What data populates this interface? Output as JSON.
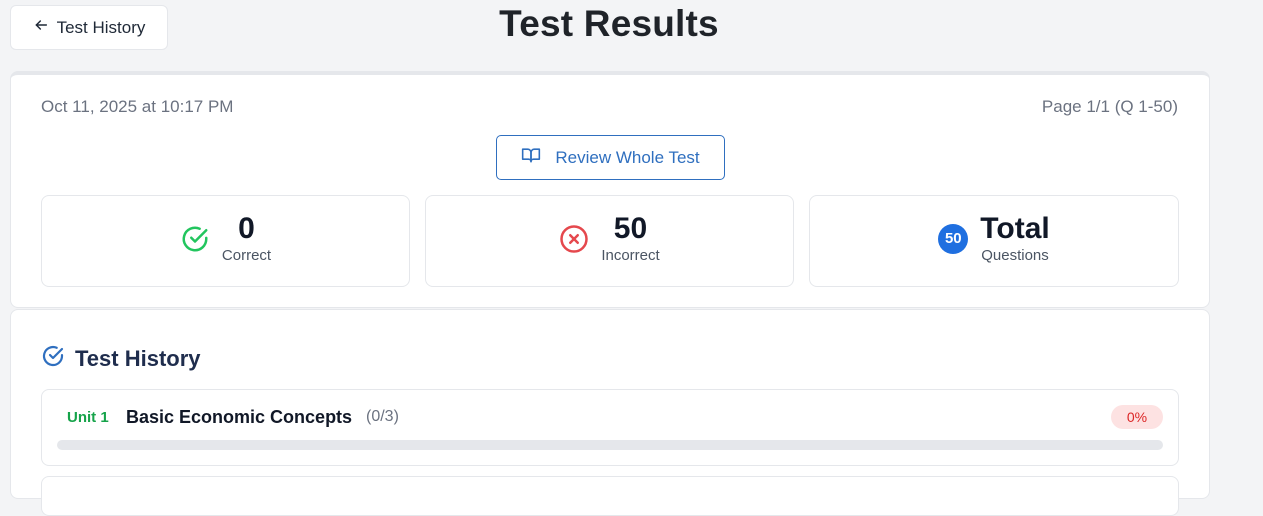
{
  "header": {
    "back_label": "Test History",
    "title": "Test Results"
  },
  "summary": {
    "date": "Oct 11, 2025 at 10:17 PM",
    "page_info": "Page 1/1 (Q 1-50)",
    "review_label": "Review Whole Test",
    "stats": {
      "correct": {
        "value": "0",
        "label": "Correct",
        "icon": "check-circle-icon",
        "color": "#22c55e"
      },
      "incorrect": {
        "value": "50",
        "label": "Incorrect",
        "icon": "x-circle-icon",
        "color": "#e5484d"
      },
      "total": {
        "badge": "50",
        "value": "Total",
        "label": "Questions",
        "color": "#1f6fe0"
      }
    }
  },
  "history": {
    "title": "Test History",
    "units": [
      {
        "tag": "Unit 1",
        "name": "Basic Economic Concepts",
        "score": "(0/3)",
        "percent": "0%",
        "progress": 0
      }
    ]
  },
  "colors": {
    "accent_blue": "#2f6fbf",
    "unit_green": "#16a34a",
    "percent_badge_bg": "#fde2e2",
    "percent_badge_text": "#dc2626"
  }
}
